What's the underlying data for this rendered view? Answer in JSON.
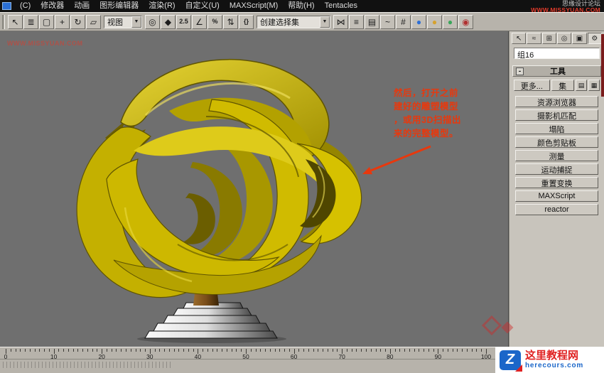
{
  "colors": {
    "vp": "#6f6f6f",
    "ui": "#b7b3ab",
    "panel": "#c8c4bc",
    "menu_bg": "#111111",
    "annotation_red": "#e8380d",
    "gold": "#d0bb00",
    "logo_blue": "#1b66c9",
    "logo_red": "#e02222"
  },
  "menu": {
    "items": [
      "(C)",
      "修改器",
      "动画",
      "图形编辑器",
      "渲染(R)",
      "自定义(U)",
      "MAXScript(M)",
      "帮助(H)",
      "Tentacles"
    ]
  },
  "brand": {
    "line1": "思缘设计论坛",
    "line2": "WWW.MISSYUAN.COM"
  },
  "toolbar": {
    "view_combo": "视图",
    "selection_combo": "创建选择集",
    "groups": {
      "a": [
        {
          "name": "select-object-icon",
          "glyph": "↖"
        },
        {
          "name": "select-by-name-icon",
          "glyph": "≣"
        },
        {
          "name": "selection-region-icon",
          "glyph": "▢"
        },
        {
          "name": "select-move-icon",
          "glyph": "+"
        },
        {
          "name": "select-rotate-icon",
          "glyph": "↻"
        },
        {
          "name": "select-scale-icon",
          "glyph": "▱"
        }
      ],
      "b": [
        {
          "name": "use-pivot-center-icon",
          "glyph": "◎"
        },
        {
          "name": "select-manipulate-icon",
          "glyph": "◆"
        },
        {
          "name": "snap-toggle-icon",
          "glyph": "2.5",
          "text": true
        },
        {
          "name": "angle-snap-icon",
          "glyph": "∠"
        },
        {
          "name": "percent-snap-icon",
          "glyph": "%",
          "text": true
        },
        {
          "name": "spinner-snap-icon",
          "glyph": "⇅"
        },
        {
          "name": "named-sets-icon",
          "glyph": "{}",
          "text": true
        }
      ],
      "c": [
        {
          "name": "mirror-icon",
          "glyph": "⋈"
        },
        {
          "name": "align-icon",
          "glyph": "≡"
        },
        {
          "name": "layer-manager-icon",
          "glyph": "▤"
        },
        {
          "name": "curve-editor-icon",
          "glyph": "~"
        },
        {
          "name": "schematic-view-icon",
          "glyph": "#"
        },
        {
          "name": "material-editor-icon",
          "glyph": "●",
          "color": "#2e6fd6"
        },
        {
          "name": "render-setup-icon",
          "glyph": "●",
          "color": "#d6a22e"
        },
        {
          "name": "render-preview-icon",
          "glyph": "●",
          "color": "#3aa65a"
        },
        {
          "name": "quick-render-icon",
          "glyph": "◉",
          "color": "#b03030"
        }
      ]
    }
  },
  "viewport": {
    "watermark": "WWW.MISSYUAN.COM",
    "annotation": [
      "然后，打开之前",
      "建好的雕塑模型",
      "，或用3D扫描出",
      "来的完整模型。"
    ]
  },
  "panel": {
    "tabs": [
      {
        "name": "create-tab",
        "glyph": "↖"
      },
      {
        "name": "modify-tab",
        "glyph": "≈"
      },
      {
        "name": "hierarchy-tab",
        "glyph": "⊞"
      },
      {
        "name": "motion-tab",
        "glyph": "◎"
      },
      {
        "name": "display-tab",
        "glyph": "▣"
      },
      {
        "name": "utilities-tab",
        "glyph": "⚙",
        "active": true
      }
    ],
    "group_name": "组16",
    "rollout": {
      "collapse": "-",
      "title": "工具"
    },
    "top_buttons": [
      "更多...",
      "集"
    ],
    "mini_icons": [
      {
        "name": "utility-config-icon",
        "glyph": "▤"
      },
      {
        "name": "utility-notes-icon",
        "glyph": "▦"
      }
    ],
    "utilities": [
      "资源浏览器",
      "摄影机匹配",
      "塌陷",
      "颜色剪贴板",
      "测量",
      "运动捕捉",
      "重置变换",
      "MAXScript",
      "reactor"
    ]
  },
  "timeline": {
    "min": 0,
    "max": 100,
    "labels": [
      "0",
      "10",
      "20",
      "30",
      "40",
      "50",
      "60",
      "70",
      "80",
      "90",
      "100"
    ]
  },
  "logo": {
    "glyph": "Z",
    "title": "这里教程网",
    "domain": "herecours.com"
  }
}
